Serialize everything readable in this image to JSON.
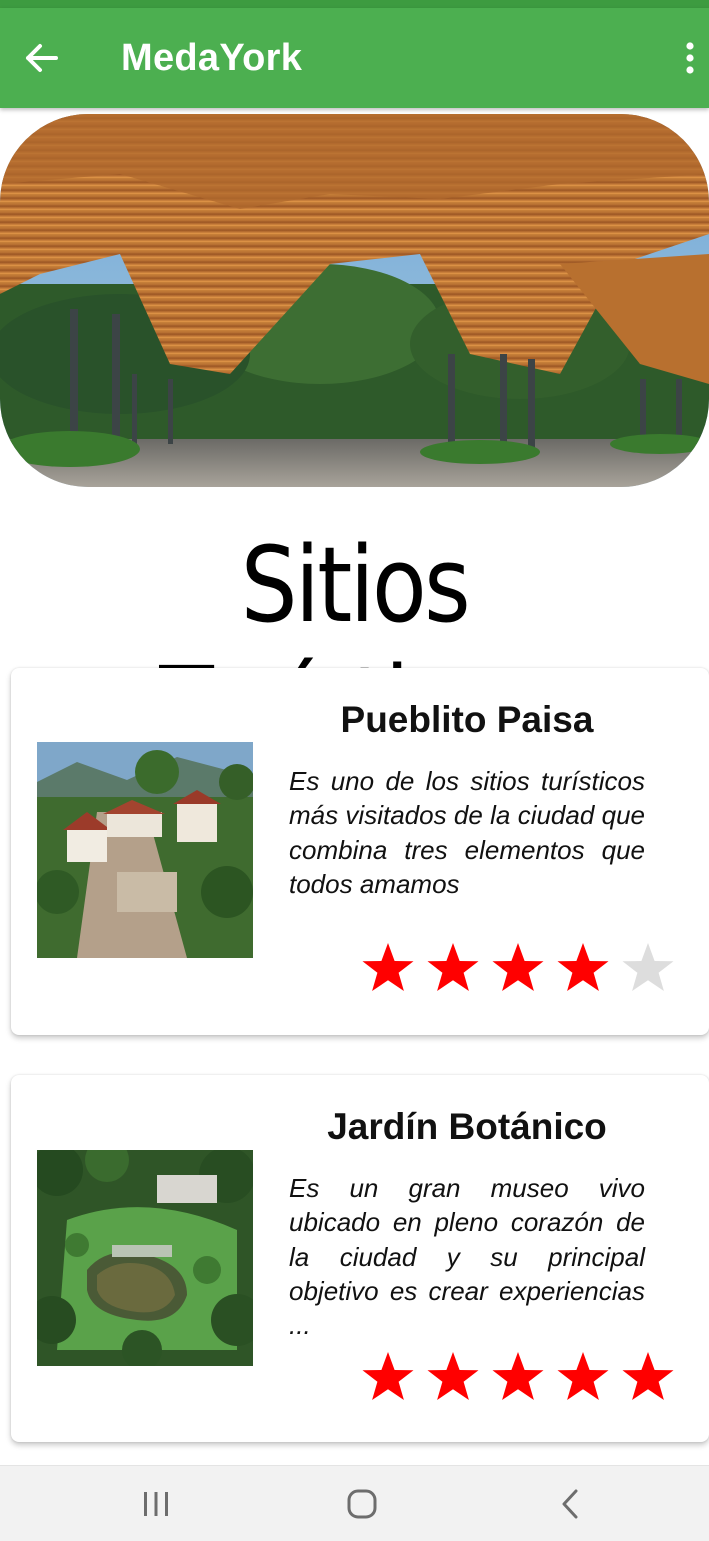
{
  "app_bar": {
    "title": "MedaYork",
    "back_icon": "arrow-left-icon",
    "menu_icon": "more-vertical-icon",
    "color": "#4caf50"
  },
  "hero": {
    "image": "botanical-garden-orquideorama-photo"
  },
  "section": {
    "title": "Sitios Turísticos"
  },
  "places": [
    {
      "name": "Pueblito Paisa",
      "description": "Es uno de los sitios turísticos más visitados de la ciudad que combina tres elementos que todos amamos",
      "rating": 4,
      "max_rating": 5,
      "image": "pueblito-paisa-photo"
    },
    {
      "name": "Jardín Botánico",
      "description": "Es un gran museo vivo ubicado en pleno corazón de la ciudad y su principal objetivo es crear experiencias ...",
      "rating": 5,
      "max_rating": 5,
      "image": "jardin-botanico-photo"
    }
  ],
  "colors": {
    "star_filled": "#ff0000",
    "star_empty": "#dddddd"
  },
  "nav_bar": {
    "icons": [
      "recent-apps-icon",
      "home-icon",
      "back-icon"
    ]
  }
}
